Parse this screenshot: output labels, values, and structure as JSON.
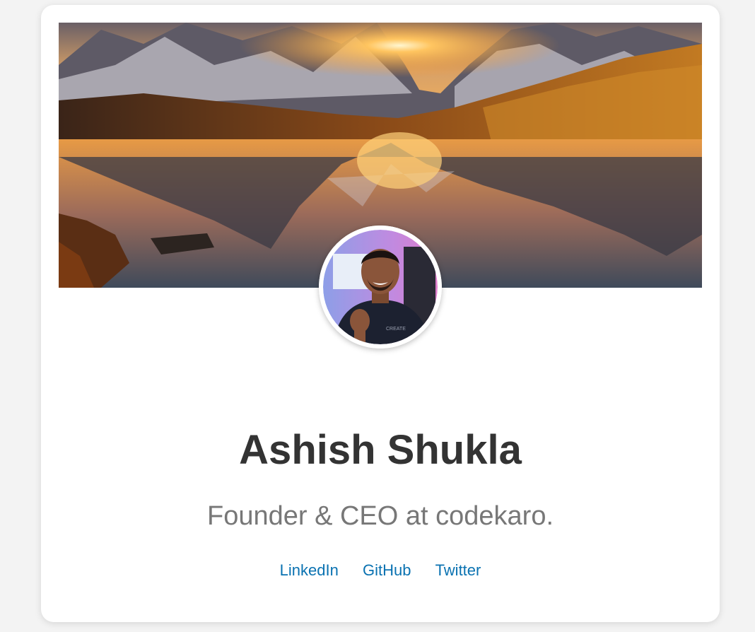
{
  "profile": {
    "name": "Ashish Shukla",
    "role": "Founder & CEO at codekaro."
  },
  "social_links": [
    {
      "label": "LinkedIn"
    },
    {
      "label": "GitHub"
    },
    {
      "label": "Twitter"
    }
  ],
  "colors": {
    "page_background": "#f3f3f3",
    "card_background": "#ffffff",
    "name_text": "#333333",
    "role_text": "#777777",
    "link": "#0a72b1"
  }
}
